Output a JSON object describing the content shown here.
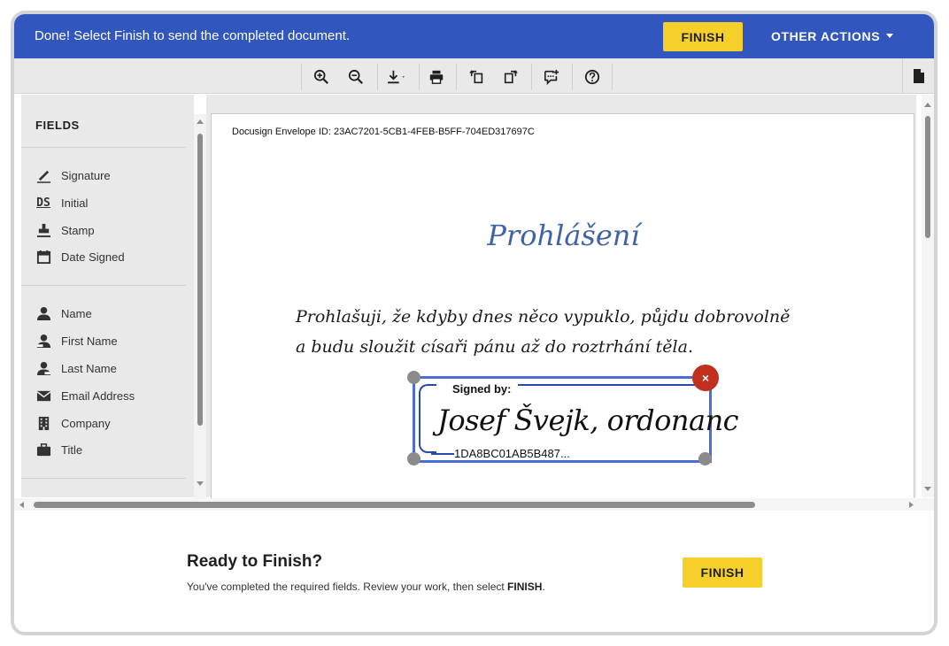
{
  "banner": {
    "message": "Done! Select Finish to send the completed document.",
    "finish_label": "FINISH",
    "other_actions_label": "OTHER ACTIONS",
    "color": "#3156bd"
  },
  "toolbar": {
    "tools": [
      "zoom-in-icon",
      "zoom-out-icon",
      "download-icon",
      "print-icon",
      "rotate-left-icon",
      "rotate-right-icon",
      "add-comment-icon",
      "help-icon"
    ],
    "doc_tab_icon": "document-icon"
  },
  "fields": {
    "title": "FIELDS",
    "group1": [
      {
        "label": "Signature",
        "icon": "signature-icon"
      },
      {
        "label": "Initial",
        "icon": "initial-icon"
      },
      {
        "label": "Stamp",
        "icon": "stamp-icon"
      },
      {
        "label": "Date Signed",
        "icon": "calendar-icon"
      }
    ],
    "group2": [
      {
        "label": "Name",
        "icon": "person-icon"
      },
      {
        "label": "First Name",
        "icon": "person-first-icon"
      },
      {
        "label": "Last Name",
        "icon": "person-last-icon"
      },
      {
        "label": "Email Address",
        "icon": "envelope-icon"
      },
      {
        "label": "Company",
        "icon": "building-icon"
      },
      {
        "label": "Title",
        "icon": "briefcase-icon"
      }
    ]
  },
  "document": {
    "envelope_id": "Docusign Envelope ID: 23AC7201-5CB1-4FEB-B5FF-704ED317697C",
    "title": "Prohlášení",
    "body_line1": "Prohlašuji, že kdyby dnes něco vypuklo, půjdu dobrovolně",
    "body_line2": "a budu sloužit císaři pánu až do roztrhání těla.",
    "signature": {
      "label": "Signed by:",
      "name": "Josef Švejk, ordonanc",
      "id": "1DA8BC01AB5B487...",
      "delete_symbol": "×"
    }
  },
  "footer": {
    "title": "Ready to Finish?",
    "text_before": "You've completed the required fields. Review your work, then select ",
    "text_bold": "FINISH",
    "text_after": ".",
    "finish_label": "FINISH"
  }
}
